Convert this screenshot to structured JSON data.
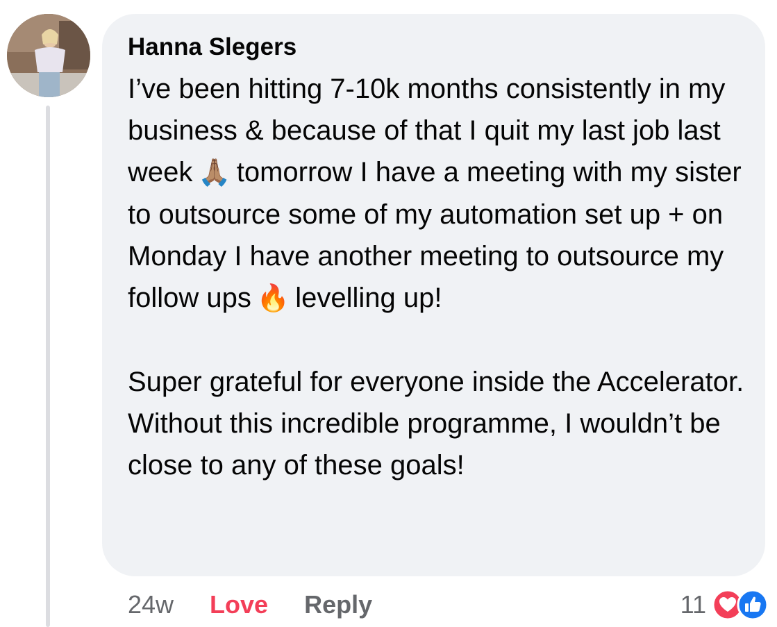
{
  "comment": {
    "author": "Hanna Slegers",
    "paragraph1_part1": "I’ve been hitting 7-10k months consistently in my business & because of that I quit my last job last week",
    "emoji_pray": "🙏🏽",
    "paragraph1_part2": "tomorrow I have a meeting with my sister to outsource some of my automation set up + on Monday I have another meeting to outsource my follow ups",
    "emoji_fire": "🔥",
    "paragraph1_part3": "levelling up!",
    "paragraph2": "Super grateful for everyone inside the Accelerator. Without this incredible programme, I wouldn’t be close to any of these goals!"
  },
  "actions": {
    "timestamp": "24w",
    "love_label": "Love",
    "reply_label": "Reply"
  },
  "reactions": {
    "count": "11",
    "icons": [
      "love-reaction-icon",
      "like-reaction-icon"
    ]
  },
  "colors": {
    "bubble_bg": "#f0f2f5",
    "love_red": "#f33e58",
    "like_blue": "#1877f2",
    "muted_text": "#65676b"
  }
}
